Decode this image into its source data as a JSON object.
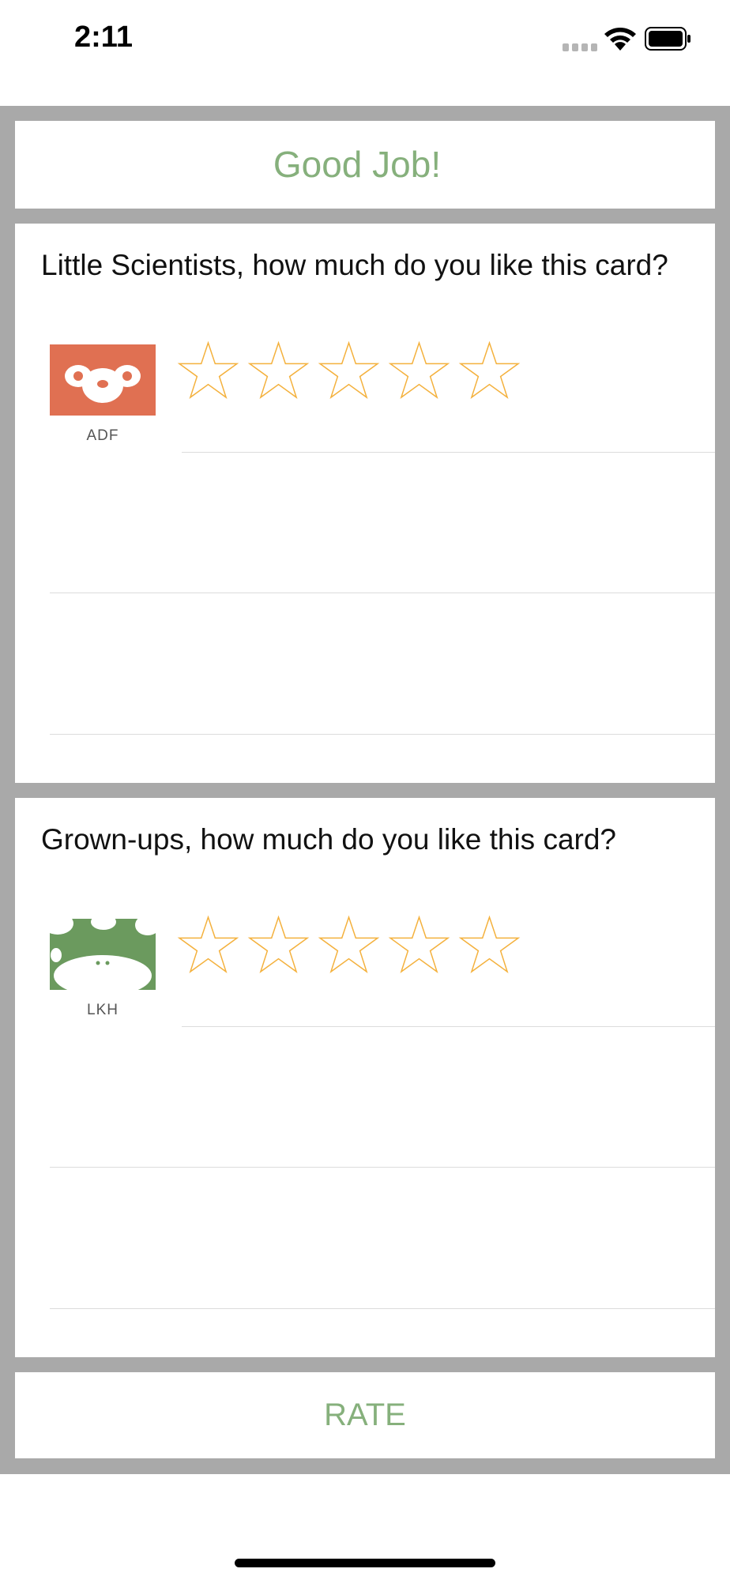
{
  "status_bar": {
    "time": "2:11"
  },
  "header": {
    "title": "Good Job!"
  },
  "ratings": [
    {
      "question": "Little Scientists, how much do you like this card?",
      "avatar_code": "ADF",
      "avatar_icon": "panda-face-icon",
      "avatar_color": "#e07052",
      "stars_total": 5,
      "stars_selected": 0
    },
    {
      "question": "Grown-ups, how much do you like this card?",
      "avatar_code": "LKH",
      "avatar_icon": "cow-face-icon",
      "avatar_color": "#6b9a5e",
      "stars_total": 5,
      "stars_selected": 0
    }
  ],
  "rate_button": {
    "label": "RATE"
  },
  "colors": {
    "accent": "#86b07c",
    "frame": "#a9a9a9",
    "star_outline": "#f4b13d"
  }
}
